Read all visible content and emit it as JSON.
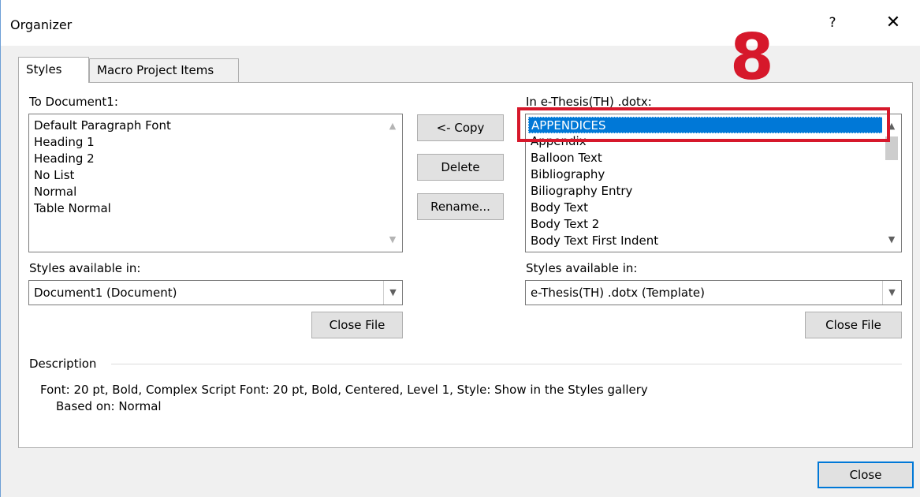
{
  "dialog": {
    "title": "Organizer",
    "help_label": "?",
    "close_glyph": "✕"
  },
  "tabs": [
    {
      "label": "Styles",
      "active": true
    },
    {
      "label": "Macro Project Items",
      "active": false
    }
  ],
  "left": {
    "label": "To Document1:",
    "items": [
      "Default Paragraph Font",
      "Heading 1",
      "Heading 2",
      "No List",
      "Normal",
      "Table Normal"
    ],
    "available_label": "Styles available in:",
    "available_value": "Document1 (Document)",
    "close_file_label": "Close File"
  },
  "middle": {
    "copy_label": "<- Copy",
    "delete_label": "Delete",
    "rename_label": "Rename..."
  },
  "right": {
    "label": "In e-Thesis(TH) .dotx:",
    "items": [
      "APPENDICES",
      "Appendix",
      "Balloon Text",
      "Bibliography",
      "Biliography Entry",
      "Body Text",
      "Body Text 2",
      "Body Text First Indent"
    ],
    "selected_index": 0,
    "available_label": "Styles available in:",
    "available_value": "e-Thesis(TH) .dotx (Template)",
    "close_file_label": "Close File"
  },
  "description": {
    "label": "Description",
    "line1": "Font: 20 pt, Bold, Complex Script Font: 20 pt, Bold, Centered, Level 1, Style: Show in the Styles gallery",
    "line2": "Based on: Normal"
  },
  "footer": {
    "close_label": "Close"
  },
  "annotation": {
    "number": "8",
    "color": "#d6182b"
  },
  "colors": {
    "accent": "#0078d7",
    "annotation": "#d6182b"
  },
  "icons": {
    "scroll_up": "chevron-up-icon",
    "scroll_down": "chevron-down-icon",
    "dropdown": "chevron-down-icon"
  }
}
